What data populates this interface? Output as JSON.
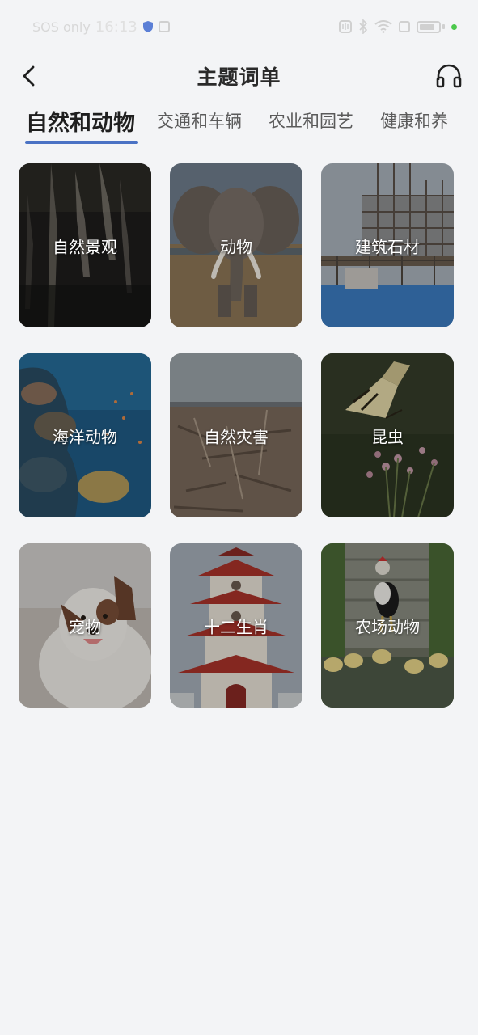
{
  "status_bar": {
    "carrier": "SOS only",
    "time": "16:13",
    "colors": {
      "indicator_dot": "#4cc84c"
    }
  },
  "header": {
    "title": "主题词单",
    "icons": {
      "back": "chevron-left-icon",
      "right": "headset-icon"
    }
  },
  "tabs": [
    {
      "label": "自然和动物",
      "active": true
    },
    {
      "label": "交通和车辆",
      "active": false
    },
    {
      "label": "农业和园艺",
      "active": false
    },
    {
      "label": "健康和养",
      "active": false
    }
  ],
  "accent_color": "#4a72c4",
  "categories": [
    {
      "label": "自然景观",
      "image": "waterfall-cliff"
    },
    {
      "label": "动物",
      "image": "elephant"
    },
    {
      "label": "建筑石材",
      "image": "construction-site"
    },
    {
      "label": "海洋动物",
      "image": "coral-reef"
    },
    {
      "label": "自然灾害",
      "image": "debris-field"
    },
    {
      "label": "昆虫",
      "image": "butterfly-on-flower"
    },
    {
      "label": "宠物",
      "image": "dog"
    },
    {
      "label": "十二生肖",
      "image": "pagoda"
    },
    {
      "label": "农场动物",
      "image": "rooster-and-ducklings"
    }
  ]
}
